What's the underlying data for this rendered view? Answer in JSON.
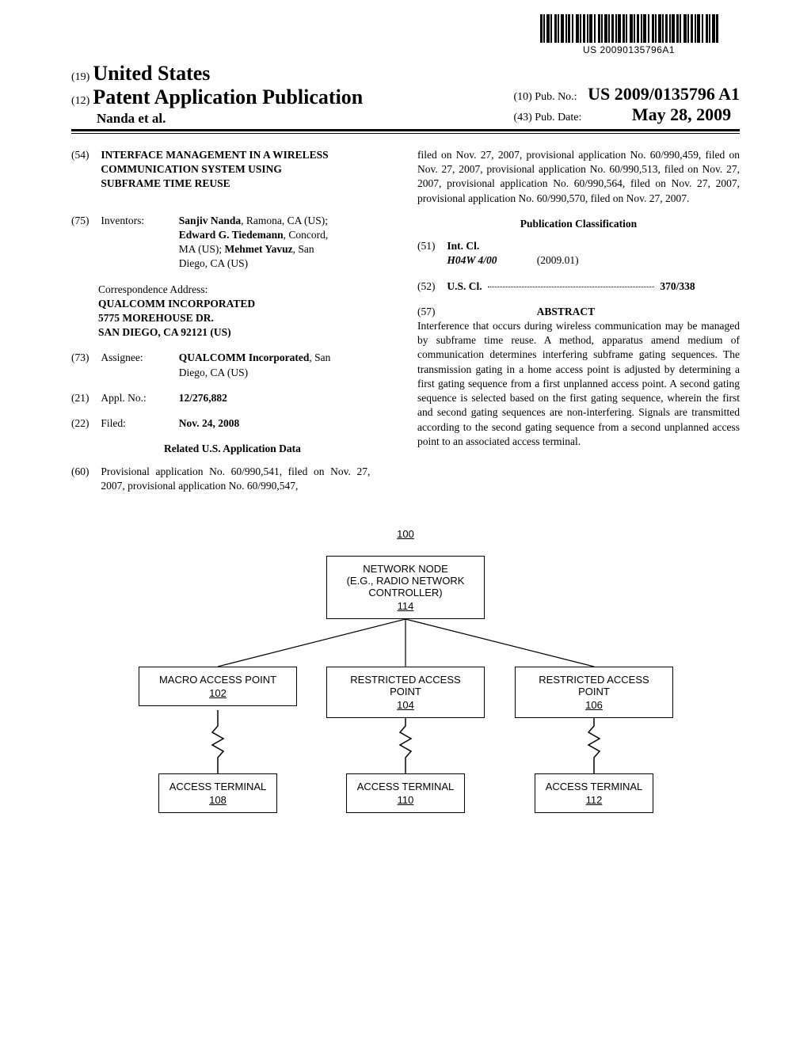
{
  "barcode_text": "US 20090135796A1",
  "header": {
    "code19": "(19)",
    "country": "United States",
    "code12": "(12)",
    "pap": "Patent Application Publication",
    "authors": "Nanda et al.",
    "code10": "(10)",
    "pubno_label": "Pub. No.:",
    "pubno_val": "US 2009/0135796 A1",
    "code43": "(43)",
    "pubdate_label": "Pub. Date:",
    "pubdate_val": "May 28, 2009"
  },
  "f54": {
    "code": "(54)",
    "title": "INTERFACE MANAGEMENT IN A WIRELESS COMMUNICATION SYSTEM USING SUBFRAME TIME REUSE"
  },
  "f75": {
    "code": "(75)",
    "label": "Inventors:",
    "val_pre": "Sanjiv Nanda",
    "val1": ", Ramona, CA (US); ",
    "val_b2": "Edward G. Tiedemann",
    "val2": ", Concord, MA (US); ",
    "val_b3": "Mehmet Yavuz",
    "val3": ", San Diego, CA (US)"
  },
  "corr": {
    "lead": "Correspondence Address:",
    "l1": "QUALCOMM INCORPORATED",
    "l2": "5775 MOREHOUSE DR.",
    "l3": "SAN DIEGO, CA 92121 (US)"
  },
  "f73": {
    "code": "(73)",
    "label": "Assignee:",
    "val_b": "QUALCOMM Incorporated",
    "val": ", San Diego, CA (US)"
  },
  "f21": {
    "code": "(21)",
    "label": "Appl. No.:",
    "val": "12/276,882"
  },
  "f22": {
    "code": "(22)",
    "label": "Filed:",
    "val": "Nov. 24, 2008"
  },
  "related_head": "Related U.S. Application Data",
  "f60": {
    "code": "(60)",
    "text": "Provisional application No. 60/990,541, filed on Nov. 27, 2007, provisional application No. 60/990,547,"
  },
  "related_cont": "filed on Nov. 27, 2007, provisional application No. 60/990,459, filed on Nov. 27, 2007, provisional application No. 60/990,513, filed on Nov. 27, 2007, provisional application No. 60/990,564, filed on Nov. 27, 2007, provisional application No. 60/990,570, filed on Nov. 27, 2007.",
  "pubclass_head": "Publication Classification",
  "f51": {
    "code": "(51)",
    "label": "Int. Cl.",
    "cls": "H04W 4/00",
    "date": "(2009.01)"
  },
  "f52": {
    "code": "(52)",
    "label": "U.S. Cl.",
    "val": "370/338"
  },
  "f57": {
    "code": "(57)",
    "label": "ABSTRACT"
  },
  "abstract": "Interference that occurs during wireless communication may be managed by subframe time reuse. A method, apparatus amend medium of communication determines interfering subframe gating sequences. The transmission gating in a home access point is adjusted by determining a first gating sequence from a first unplanned access point. A second gating sequence is selected based on the first gating sequence, wherein the first and second gating sequences are non-interfering. Signals are transmitted according to the second gating sequence from a second unplanned access point to an associated access terminal.",
  "fig": {
    "num": "100",
    "nn_l1": "NETWORK NODE",
    "nn_l2": "(E.G., RADIO NETWORK",
    "nn_l3": "CONTROLLER)",
    "nn_ref": "114",
    "map_l1": "MACRO ACCESS POINT",
    "map_ref": "102",
    "rap1_l1": "RESTRICTED ACCESS POINT",
    "rap1_ref": "104",
    "rap2_l1": "RESTRICTED ACCESS POINT",
    "rap2_ref": "106",
    "at1_l1": "ACCESS TERMINAL",
    "at1_ref": "108",
    "at2_l1": "ACCESS TERMINAL",
    "at2_ref": "110",
    "at3_l1": "ACCESS TERMINAL",
    "at3_ref": "112"
  }
}
